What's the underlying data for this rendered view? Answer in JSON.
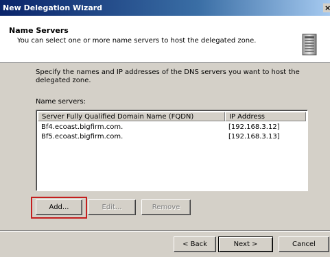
{
  "window": {
    "title": "New Delegation Wizard",
    "close_glyph": "×"
  },
  "header": {
    "title": "Name Servers",
    "subtitle": "You can select one or more name servers to host the delegated zone.",
    "icon": "server-icon"
  },
  "main": {
    "instructions": "Specify the names and IP addresses of the DNS servers you want to host the delegated zone.",
    "name_servers_label": "Name servers:",
    "columns": [
      "Server Fully Qualified Domain Name (FQDN)",
      "IP Address"
    ],
    "rows": [
      {
        "fqdn": "Bf4.ecoast.bigfirm.com.",
        "ip": "[192.168.3.12]"
      },
      {
        "fqdn": "Bf5.ecoast.bigfirm.com.",
        "ip": "[192.168.3.13]"
      }
    ],
    "buttons": {
      "add": "Add...",
      "edit": "Edit...",
      "remove": "Remove"
    }
  },
  "footer": {
    "back": "< Back",
    "next": "Next >",
    "cancel": "Cancel"
  },
  "colors": {
    "highlight": "#c41e1e",
    "titlebar": "#0a246a"
  }
}
